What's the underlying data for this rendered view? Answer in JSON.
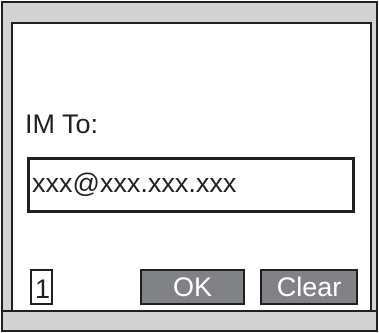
{
  "dialog": {
    "label": "IM To:",
    "address_value": "xxx@xxx.xxx.xxx",
    "char_counter": "1"
  },
  "softkeys": {
    "ok_label": "OK",
    "clear_label": "Clear"
  },
  "colors": {
    "frame": "#231f20",
    "chrome_gray": "#d1d3d4",
    "softkey_gray": "#808285",
    "content_bg": "#ffffff"
  }
}
